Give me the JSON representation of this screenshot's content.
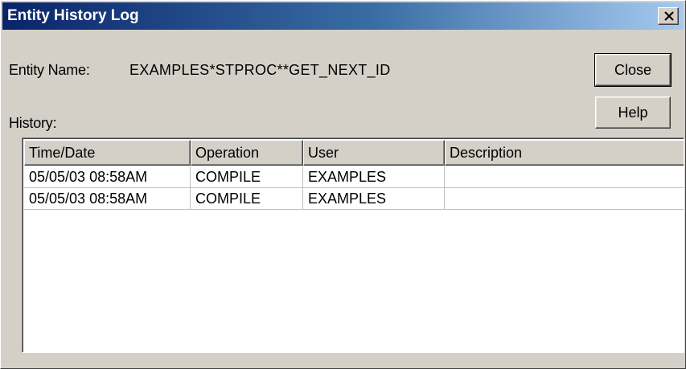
{
  "window": {
    "title": "Entity History Log",
    "close_glyph": "×"
  },
  "entity": {
    "label": "Entity Name:",
    "value": "EXAMPLES*STPROC**GET_NEXT_ID"
  },
  "buttons": {
    "close_label": "Close",
    "help_label": "Help"
  },
  "history": {
    "label": "History:",
    "columns": [
      "Time/Date",
      "Operation",
      "User",
      "Description"
    ],
    "rows": [
      [
        "05/05/03 08:58AM",
        "COMPILE",
        "EXAMPLES",
        ""
      ],
      [
        "05/05/03 08:58AM",
        "COMPILE",
        "EXAMPLES",
        ""
      ]
    ]
  },
  "colors": {
    "titlebar_start": "#0a246a",
    "titlebar_end": "#a6caf0",
    "dialog_face": "#d4d0c8"
  },
  "icons": {
    "title_close": "close-icon"
  }
}
